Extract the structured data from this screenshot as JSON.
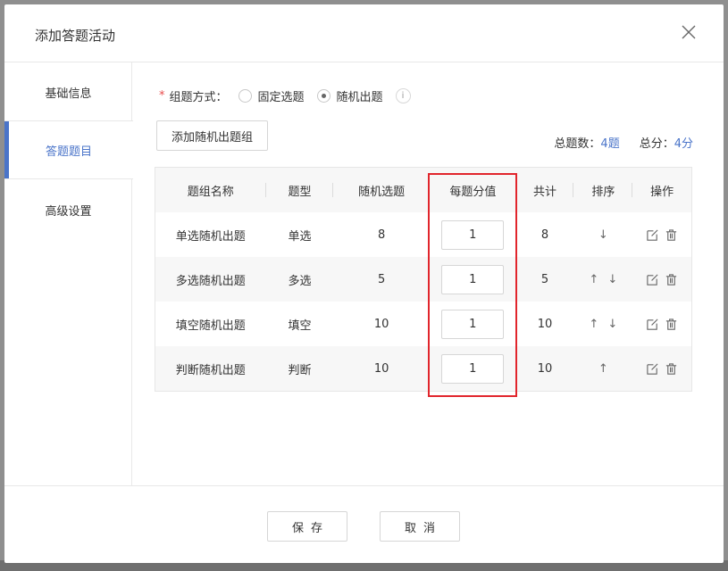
{
  "modal": {
    "title": "添加答题活动"
  },
  "sidebar": {
    "items": [
      {
        "label": "基础信息"
      },
      {
        "label": "答题题目"
      },
      {
        "label": "高级设置"
      }
    ]
  },
  "mode": {
    "label": "组题方式：",
    "required_mark": "*",
    "options": [
      {
        "label": "固定选题",
        "checked": false
      },
      {
        "label": "随机出题",
        "checked": true
      }
    ],
    "info_glyph": "i"
  },
  "toolbar": {
    "add_group_label": "添加随机出题组"
  },
  "summary": {
    "total_questions_label": "总题数：",
    "total_questions_value": "4题",
    "total_score_label": "总分：",
    "total_score_value": "4分"
  },
  "table": {
    "headers": [
      "题组名称",
      "题型",
      "随机选题",
      "每题分值",
      "共计",
      "排序",
      "操作"
    ],
    "rows": [
      {
        "name": "单选随机出题",
        "type": "单选",
        "random": "8",
        "score": "1",
        "total": "8",
        "up": false,
        "down": true
      },
      {
        "name": "多选随机出题",
        "type": "多选",
        "random": "5",
        "score": "1",
        "total": "5",
        "up": true,
        "down": true
      },
      {
        "name": "填空随机出题",
        "type": "填空",
        "random": "10",
        "score": "1",
        "total": "10",
        "up": true,
        "down": true
      },
      {
        "name": "判断随机出题",
        "type": "判断",
        "random": "10",
        "score": "1",
        "total": "10",
        "up": true,
        "down": false
      }
    ]
  },
  "footer": {
    "save_label": "保存",
    "cancel_label": "取消"
  },
  "icons": {
    "close": "close-icon",
    "edit": "edit-icon",
    "delete": "trash-icon",
    "info": "info-icon",
    "up": "arrow-up-icon",
    "down": "arrow-down-icon"
  },
  "colors": {
    "accent": "#4a74c9",
    "required": "#e84d4d",
    "highlight": "#e1252c"
  }
}
